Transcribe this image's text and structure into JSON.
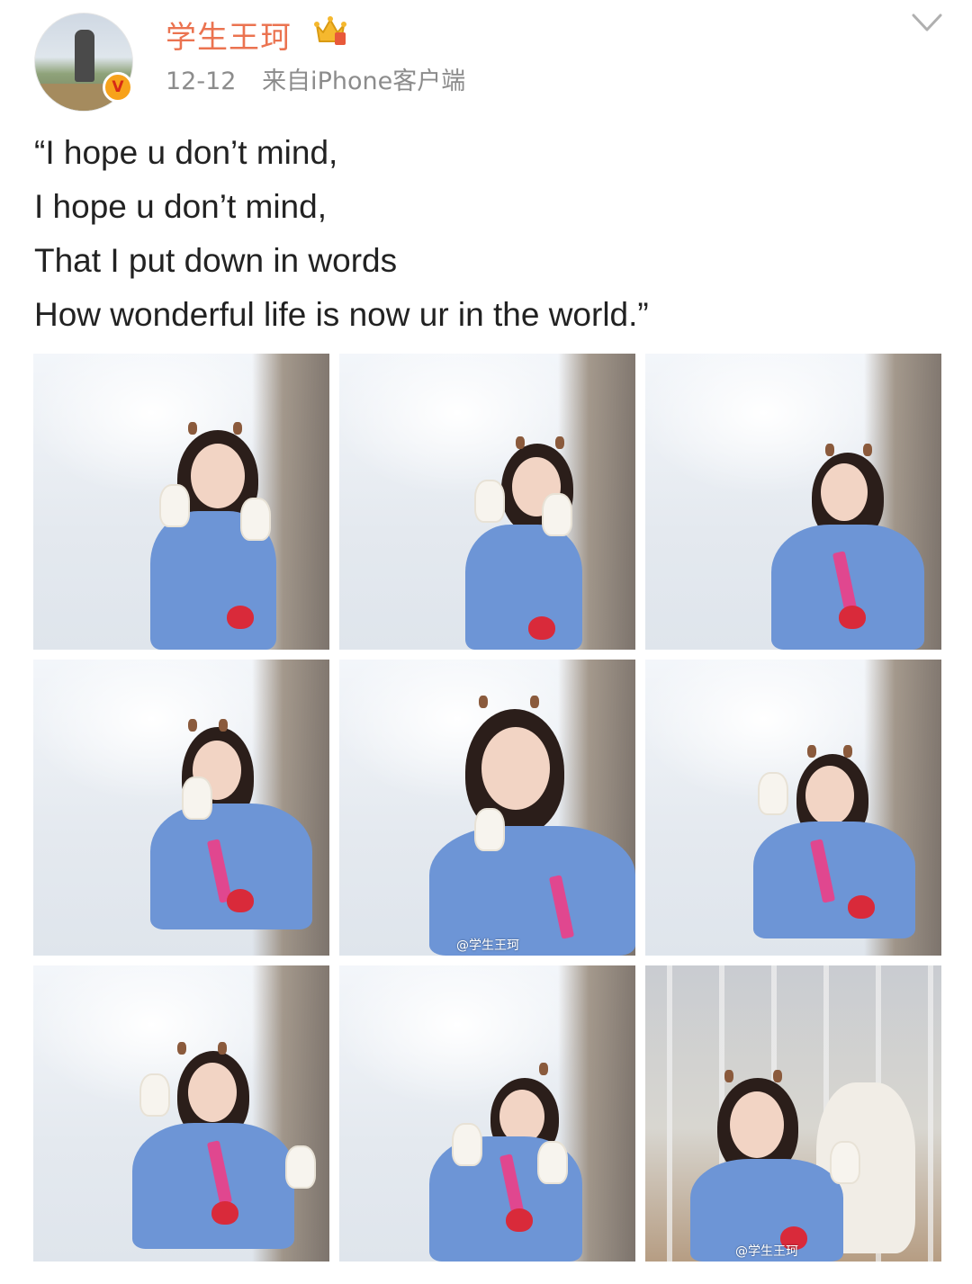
{
  "post": {
    "username": "学生王珂",
    "verified_badge": "V",
    "date": "12-12",
    "source": "来自iPhone客户端",
    "text_lines": [
      "“I hope u don’t mind,",
      "I hope u don’t mind,",
      "That I put down in words",
      "How wonderful life is now ur in the world.”"
    ],
    "watermark": "@学生王珂"
  },
  "icons": {
    "avatar": "avatar-photo",
    "badge": "verified-v-badge",
    "crown": "crown-icon",
    "chevron": "chevron-down-icon"
  },
  "colors": {
    "username": "#eb7350",
    "meta": "#8c8c8c",
    "text": "#222222",
    "badge": "#f7a21b",
    "crown": "#f5b82e"
  },
  "photos": [
    {
      "id": "photo-1"
    },
    {
      "id": "photo-2"
    },
    {
      "id": "photo-3"
    },
    {
      "id": "photo-4"
    },
    {
      "id": "photo-5"
    },
    {
      "id": "photo-6"
    },
    {
      "id": "photo-7"
    },
    {
      "id": "photo-8"
    },
    {
      "id": "photo-9"
    }
  ]
}
